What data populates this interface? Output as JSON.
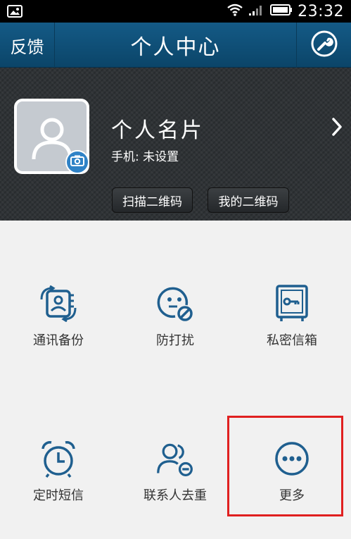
{
  "status_bar": {
    "time": "23:32",
    "left_icon": "image-icon",
    "icons": [
      "wifi-icon",
      "signal-icon",
      "battery-icon"
    ]
  },
  "header": {
    "left_label": "反馈",
    "title": "个人中心",
    "right_icon": "wrench-icon"
  },
  "profile": {
    "card_title": "个人名片",
    "phone": "手机: 未设置",
    "scan_qr_label": "扫描二维码",
    "my_qr_label": "我的二维码"
  },
  "features": [
    {
      "label": "通讯备份",
      "icon": "contacts-backup-icon"
    },
    {
      "label": "防打扰",
      "icon": "do-not-disturb-icon"
    },
    {
      "label": "私密信箱",
      "icon": "private-mailbox-icon"
    },
    {
      "label": "定时短信",
      "icon": "alarm-clock-icon"
    },
    {
      "label": "联系人去重",
      "icon": "contacts-dedup-icon"
    },
    {
      "label": "更多",
      "icon": "more-icon"
    }
  ],
  "colors": {
    "accent_blue": "#1f5f8f",
    "header_bg": "#0f5079",
    "highlight_red": "#e02020"
  }
}
